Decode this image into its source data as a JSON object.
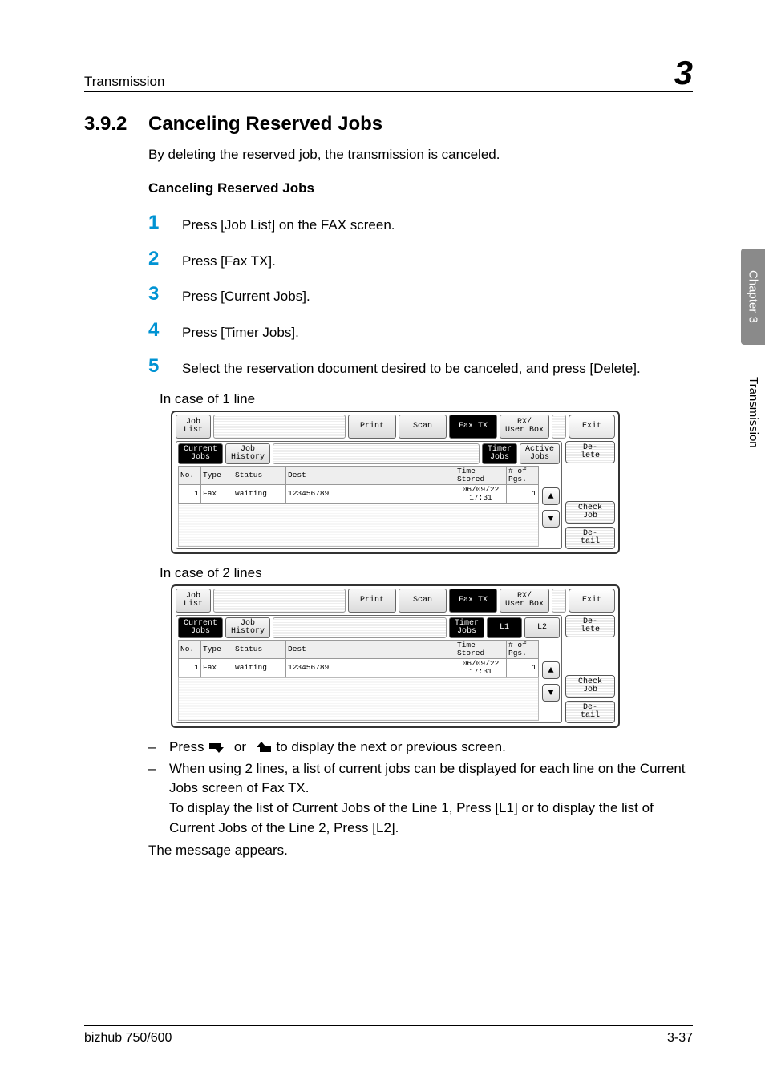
{
  "header": {
    "left": "Transmission",
    "right": "3"
  },
  "section": {
    "number": "3.9.2",
    "title": "Canceling Reserved Jobs"
  },
  "lead": "By deleting the reserved job, the transmission is canceled.",
  "subhead": "Canceling Reserved Jobs",
  "steps": [
    {
      "n": "1",
      "t": "Press [Job List] on the FAX screen."
    },
    {
      "n": "2",
      "t": "Press [Fax TX]."
    },
    {
      "n": "3",
      "t": "Press [Current Jobs]."
    },
    {
      "n": "4",
      "t": "Press [Timer Jobs]."
    },
    {
      "n": "5",
      "t": "Select the reservation document desired to be canceled, and press [Delete]."
    }
  ],
  "captions": {
    "one": "In case of 1 line",
    "two": "In case of 2 lines"
  },
  "ss": {
    "tabs_top": {
      "joblist": "Job\nList",
      "print": "Print",
      "scan": "Scan",
      "faxtx": "Fax TX",
      "rxbox": "RX/\nUser Box",
      "exit": "Exit"
    },
    "tabs_inner_a": {
      "current": "Current\nJobs",
      "history": "Job\nHistory",
      "timer": "Timer\nJobs",
      "active": "Active\nJobs"
    },
    "tabs_inner_b": {
      "current": "Current\nJobs",
      "history": "Job\nHistory",
      "timer": "Timer\nJobs",
      "l1": "L1",
      "l2": "L2"
    },
    "cols": {
      "no": "No.",
      "type": "Type",
      "status": "Status",
      "dest": "Dest",
      "time": "Time\nStored",
      "pgs": "# of\nPgs."
    },
    "row": {
      "no": "1",
      "type": "Fax",
      "status": "Waiting",
      "dest": "123456789",
      "time": "06/09/22\n17:31",
      "pgs": "1"
    },
    "right": {
      "delete": "De-\nlete",
      "check": "Check\nJob",
      "detail": "De-\ntail"
    },
    "arrows": {
      "up": "▲",
      "down": "▼"
    }
  },
  "notes": {
    "line1a": "Press ",
    "line1b": " or ",
    "line1c": " to display the next or previous screen.",
    "line2": "When using 2 lines, a list of current jobs can be displayed for each line on the Current Jobs screen of Fax TX.\nTo display the list of Current Jobs of the Line 1, Press [L1] or to display the list of Current Jobs of the Line 2, Press [L2].",
    "msg": "The message appears."
  },
  "footer": {
    "left": "bizhub 750/600",
    "right": "3-37"
  },
  "sidetab": "Chapter 3",
  "sidelabel": "Transmission",
  "dash": "–"
}
